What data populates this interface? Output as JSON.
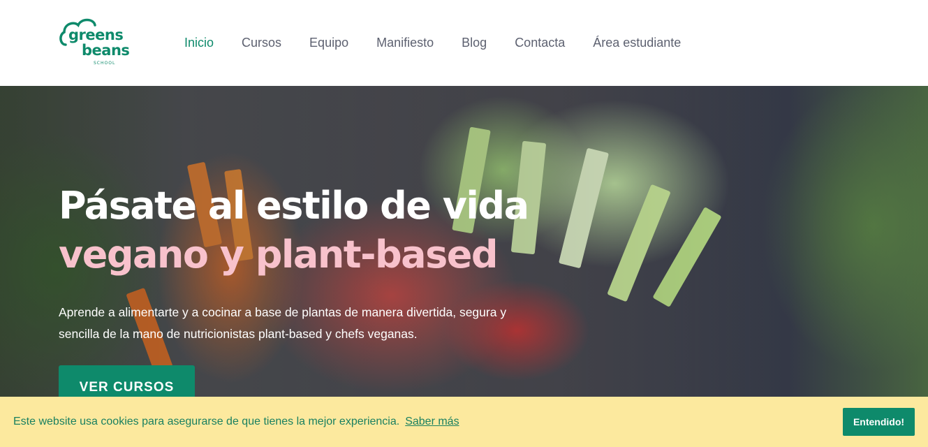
{
  "logo": {
    "line1": "greens",
    "line2": "beans",
    "line3": "SCHOOL"
  },
  "nav": {
    "items": [
      {
        "label": "Inicio",
        "active": true
      },
      {
        "label": "Cursos",
        "active": false
      },
      {
        "label": "Equipo",
        "active": false
      },
      {
        "label": "Manifiesto",
        "active": false
      },
      {
        "label": "Blog",
        "active": false
      },
      {
        "label": "Contacta",
        "active": false
      },
      {
        "label": "Área estudiante",
        "active": false
      }
    ]
  },
  "hero": {
    "title_line1": "Pásate al estilo de vida",
    "title_line2": "vegano y plant-based",
    "subtitle": "Aprende a alimentarte y a cocinar a base de plantas  de manera divertida, segura y sencilla de la mano de nutricionistas plant-based y chefs veganas.",
    "cta_label": "VER CURSOS"
  },
  "cookie": {
    "message": "Este website usa cookies para asegurarse de que tienes la mejor experiencia.",
    "link_label": "Saber más",
    "button_label": "Entendido!"
  },
  "colors": {
    "brand": "#0e8a6b",
    "accent_pink": "#f8c2cc",
    "cookie_bg": "#fce99e"
  }
}
